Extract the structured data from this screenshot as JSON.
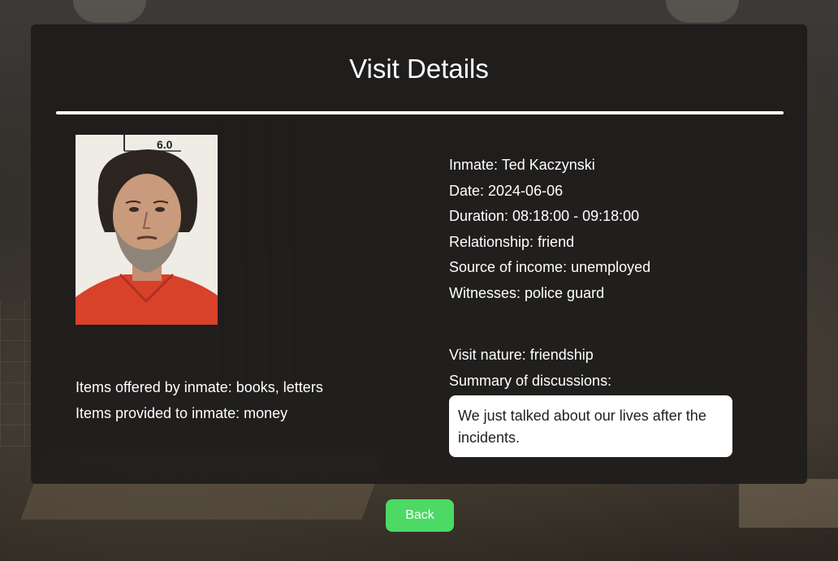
{
  "page": {
    "title": "Visit Details"
  },
  "details": {
    "inmate": "Inmate: Ted Kaczynski",
    "date": "Date: 2024-06-06",
    "duration": "Duration: 08:18:00 - 09:18:00",
    "relationship": "Relationship: friend",
    "source_of_income": "Source of income: unemployed",
    "witnesses": "Witnesses: police guard",
    "visit_nature": "Visit nature: friendship",
    "summary_label": "Summary of discussions:",
    "summary_text": "We just talked about our lives after the incidents."
  },
  "items": {
    "offered_by_inmate": "Items offered by inmate: books, letters",
    "provided_to_inmate": "Items provided to inmate: money"
  },
  "photo": {
    "placard_text": "6.0"
  },
  "actions": {
    "back_label": "Back"
  },
  "colors": {
    "accent_button": "#4cd964",
    "card_background": "#1e1c1b",
    "text": "#ffffff"
  }
}
